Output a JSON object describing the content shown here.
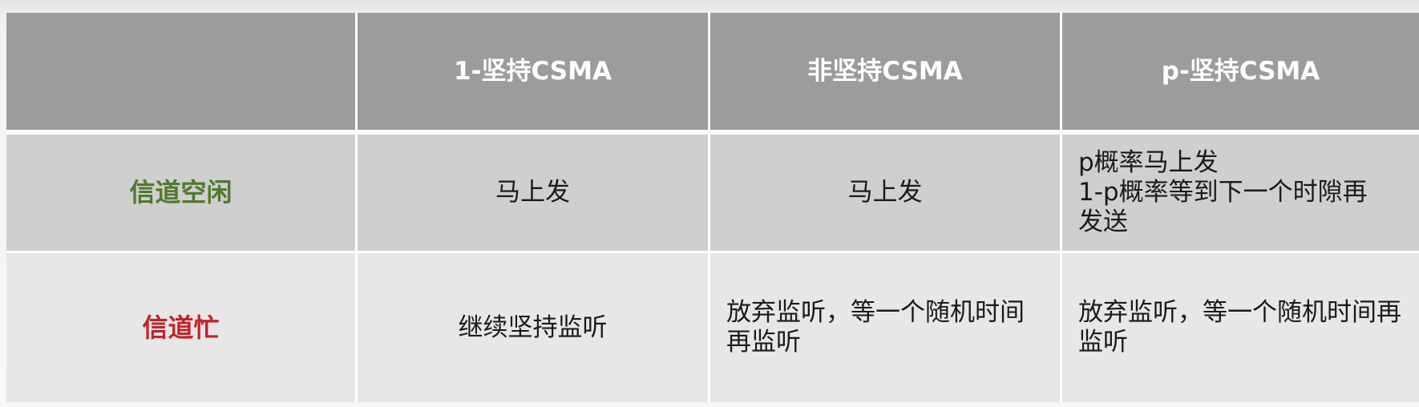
{
  "table": {
    "headers": [
      "",
      "1-坚持CSMA",
      "非坚持CSMA",
      "p-坚持CSMA"
    ],
    "rows": [
      {
        "label": "信道空闲",
        "label_color": "#4e7a2f",
        "cells": [
          "马上发",
          "马上发",
          [
            "p概率马上发",
            "1-p概率等到下一个时隙再",
            "发送"
          ]
        ]
      },
      {
        "label": "信道忙",
        "label_color": "#c0242a",
        "cells": [
          "继续坚持监听",
          "放弃监听，等一个随机时间再监听",
          "放弃监听，等一个随机时间再监听"
        ]
      }
    ]
  },
  "colors": {
    "header_bg": "#9c9c9c",
    "row1_bg": "#cfcfcf",
    "row2_bg": "#e7e7e7"
  }
}
